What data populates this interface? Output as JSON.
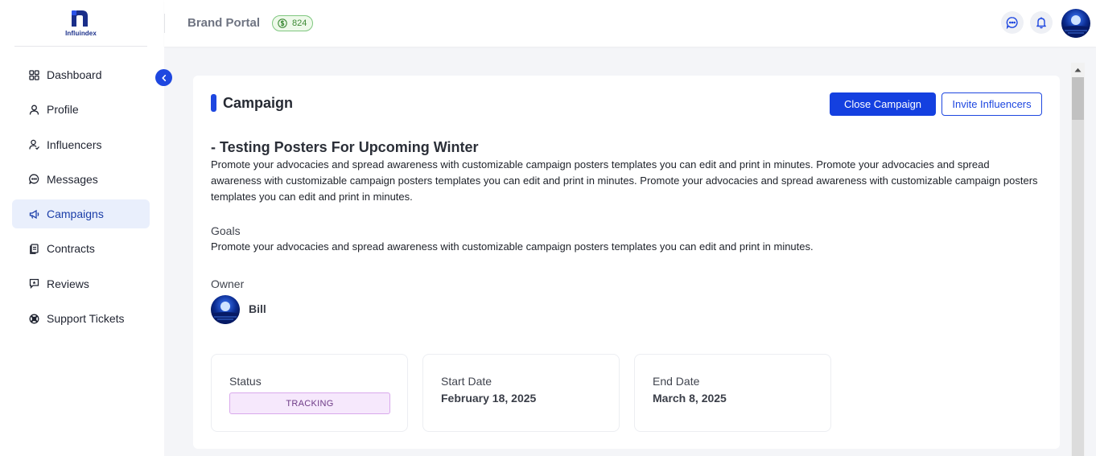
{
  "brand": {
    "logo_text": "Influindex"
  },
  "sidebar": {
    "items": [
      {
        "label": "Dashboard",
        "icon": "grid-icon",
        "active": false
      },
      {
        "label": "Profile",
        "icon": "user-icon",
        "active": false
      },
      {
        "label": "Influencers",
        "icon": "user-check-icon",
        "active": false
      },
      {
        "label": "Messages",
        "icon": "message-icon",
        "active": false
      },
      {
        "label": "Campaigns",
        "icon": "megaphone-icon",
        "active": true
      },
      {
        "label": "Contracts",
        "icon": "file-icon",
        "active": false
      },
      {
        "label": "Reviews",
        "icon": "review-icon",
        "active": false
      },
      {
        "label": "Support Tickets",
        "icon": "lifebuoy-icon",
        "active": false
      }
    ]
  },
  "header": {
    "title": "Brand Portal",
    "coins": "824"
  },
  "campaign": {
    "section_title": "Campaign",
    "close_label": "Close Campaign",
    "invite_label": "Invite Influencers",
    "name": "- Testing Posters For Upcoming Winter",
    "description": "Promote your advocacies and spread awareness with customizable campaign posters templates you can edit and print in minutes. Promote your advocacies and spread awareness with customizable campaign posters templates you can edit and print in minutes. Promote your advocacies and spread awareness with customizable campaign posters templates you can edit and print in minutes.",
    "goals_label": "Goals",
    "goals": "Promote your advocacies and spread awareness with customizable campaign posters templates you can edit and print in minutes.",
    "owner_label": "Owner",
    "owner_name": "Bill",
    "status_label": "Status",
    "status": "TRACKING",
    "start_label": "Start Date",
    "start_date": "February 18, 2025",
    "end_label": "End Date",
    "end_date": "March 8, 2025"
  },
  "colors": {
    "accent": "#1e47e0",
    "active_nav_bg": "#e9effc",
    "status_bg": "#f6e8fc",
    "status_border": "#d9a9ec",
    "coin_green": "#3d8a35"
  }
}
